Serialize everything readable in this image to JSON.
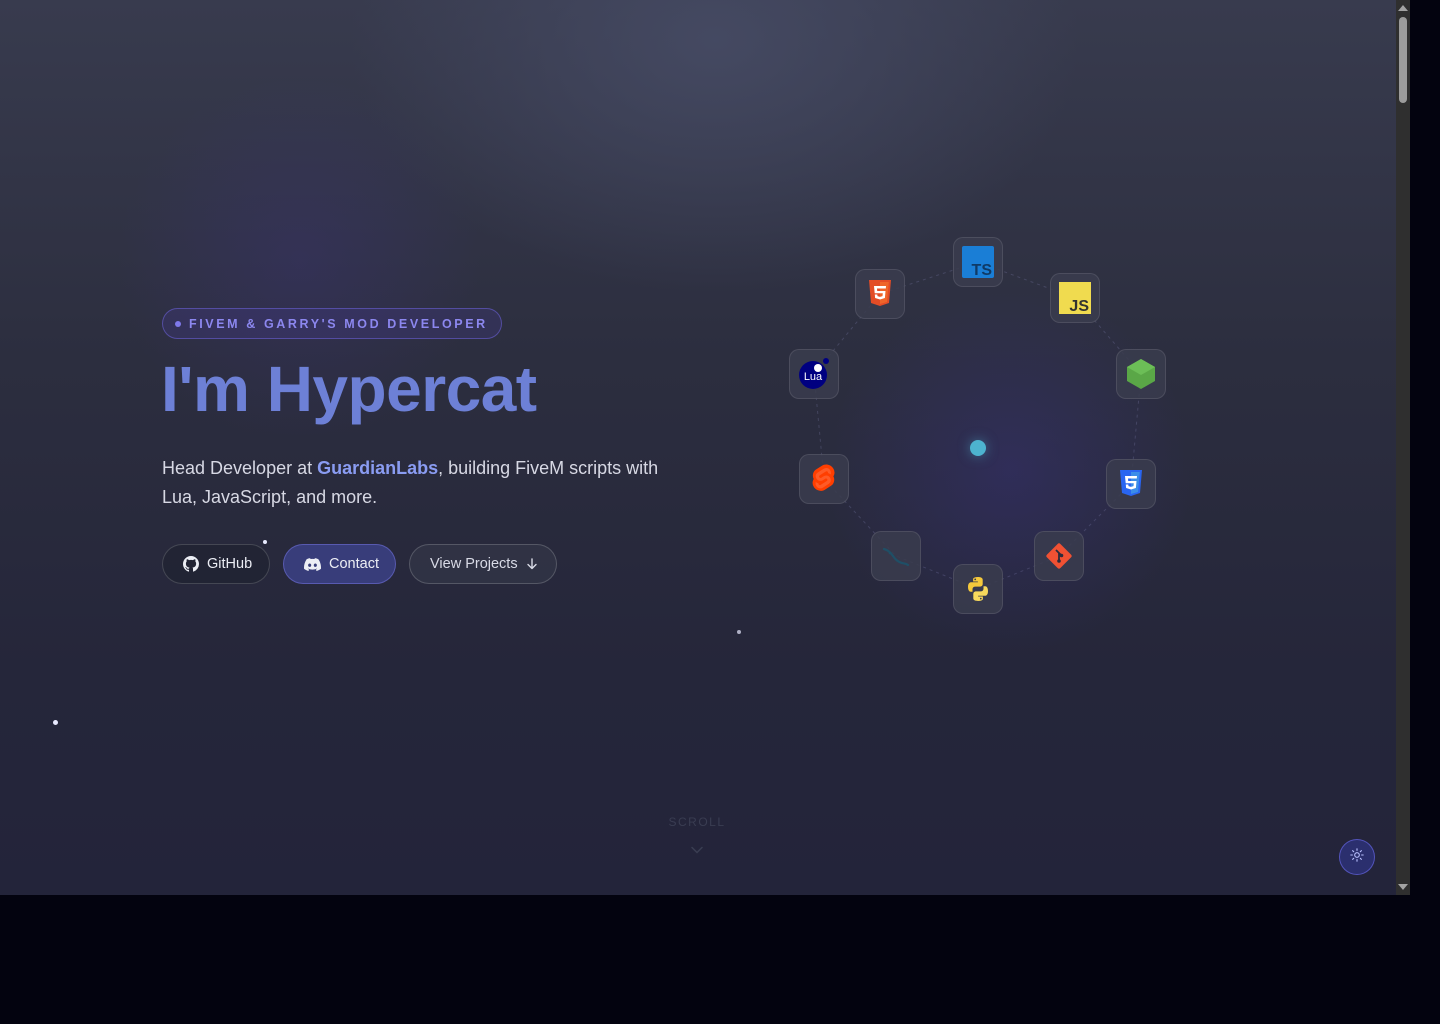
{
  "hero": {
    "badge": "FIVEM & GARRY'S MOD DEVELOPER",
    "title": "I'm Hypercat",
    "subtitle_before": "Head Developer at ",
    "subtitle_company": "GuardianLabs",
    "subtitle_after": ", building FiveM scripts with Lua, JavaScript, and more."
  },
  "buttons": {
    "github": "GitHub",
    "contact": "Contact",
    "projects": "View Projects"
  },
  "tech_icons": [
    {
      "name": "typescript-icon",
      "label": "TS"
    },
    {
      "name": "javascript-icon",
      "label": "JS"
    },
    {
      "name": "nodejs-icon",
      "label": ""
    },
    {
      "name": "css3-icon",
      "label": ""
    },
    {
      "name": "git-icon",
      "label": ""
    },
    {
      "name": "python-icon",
      "label": ""
    },
    {
      "name": "mysql-icon",
      "label": ""
    },
    {
      "name": "svelte-icon",
      "label": ""
    },
    {
      "name": "lua-icon",
      "label": "Lua"
    },
    {
      "name": "html5-icon",
      "label": ""
    }
  ],
  "scroll": {
    "label": "SCROLL"
  },
  "theme_toggle": {
    "icon": "sun-icon"
  },
  "colors": {
    "accent": "#6d80d6",
    "link": "#8a9cf2",
    "badge": "#8c87ef",
    "center": "#4db3cf"
  }
}
